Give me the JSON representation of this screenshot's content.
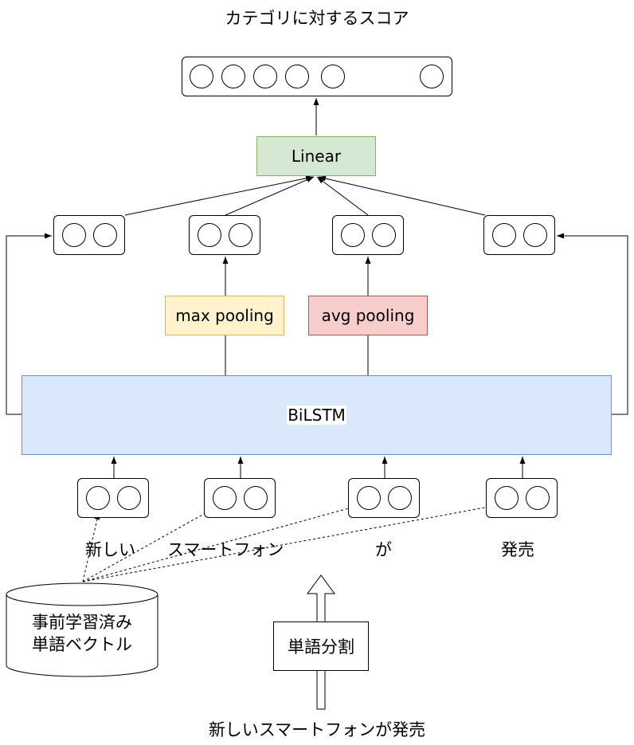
{
  "title": "カテゴリに対するスコア",
  "linear_label": "Linear",
  "max_pooling_label": "max pooling",
  "avg_pooling_label": "avg pooling",
  "bilstm_label": "BiLSTM",
  "tokens": [
    "新しい",
    "スマートフォン",
    "が",
    "発売"
  ],
  "embedding_label_line1": "事前学習済み",
  "embedding_label_line2": "単語ベクトル",
  "segmentation_label": "単語分割",
  "input_sentence": "新しいスマートフォンが発売",
  "colors": {
    "linear_fill": "#d5e8d4",
    "linear_border": "#82b366",
    "max_fill": "#fff2cc",
    "max_border": "#d6b656",
    "avg_fill": "#f8cecc",
    "avg_border": "#b85450",
    "bilstm_fill": "#dae8fc",
    "bilstm_border": "#6c8ebf"
  }
}
